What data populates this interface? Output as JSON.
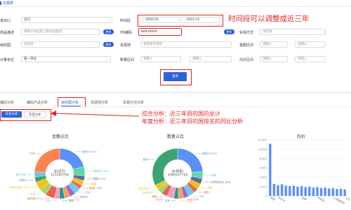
{
  "header": {
    "title": "出报表"
  },
  "form": {
    "export_label": "进出口",
    "export_value": "出口",
    "time_label": "时间段",
    "time_start": "2020-01",
    "time_end": "2022-12",
    "product_desc_label": "商品描述",
    "product_desc_placeholder": "请输入商品或上报商品描述",
    "more_label": "更多",
    "hs_label": "HS编码",
    "hs_value": "84818040",
    "trade_mode_label": "贸易方式",
    "trade_mode_placeholder": "请选择",
    "country_label": "目的国",
    "country_placeholder": "请选择",
    "origin_label": "货源地",
    "origin_placeholder": "请选择货源地",
    "amount_label": "金额区间",
    "amount_placeholder": "请输入",
    "unit_label": "计量单位",
    "unit_value": "第一单位",
    "qty_label": "数量区间",
    "qty_placeholder": "请输入",
    "price_label": "均价区间",
    "price_placeholder": "请输入",
    "query_button": "查询"
  },
  "annotations": {
    "time_note": "时间段可以调整成近三年",
    "analysis_note_1": "综合分析：近三年目的国的总计",
    "analysis_note_2": "年度分析：近三年目的国排名的同比分析"
  },
  "tabs": [
    "编码分析",
    "编码产品分析",
    "目的国分析",
    "货源地分析",
    "贸易方式分析"
  ],
  "subtabs": [
    "综合分析",
    "年度分析"
  ],
  "charts": {
    "amount_title": "金额占比",
    "qty_title": "数量占比",
    "price_title": "均价",
    "amount_center_label": "总(美元)",
    "amount_center_value": "121583708",
    "qty_center_label": "总(数量)",
    "qty_center_value": "3480437784"
  },
  "chart_data": [
    {
      "type": "pie",
      "title": "金额占比",
      "labels": [
        "美国20.54%",
        "墨西哥6.16%",
        "英国3.27%",
        "越南",
        "德国2.58%",
        "印度",
        "新加坡",
        "巴西",
        "泰国",
        "日本",
        "俄罗斯6.27%",
        "土耳其",
        "印度尼西亚5.95%",
        "加拿大",
        "澳大利亚",
        "其他"
      ],
      "values": [
        20.54,
        6.16,
        3.27,
        3.1,
        2.58,
        4.2,
        3.9,
        3.4,
        3.6,
        3.0,
        6.27,
        4.1,
        5.95,
        3.5,
        3.2,
        24.2
      ]
    },
    {
      "type": "pie",
      "title": "数量占比",
      "labels": [
        "美国23.95%",
        "越南",
        "沙特阿拉伯3.84%",
        "英国",
        "德国",
        "印度",
        "巴西",
        "泰国",
        "日本",
        "俄罗斯",
        "韩国",
        "马来西亚",
        "澳大利亚",
        "其他"
      ],
      "values": [
        23.95,
        4.47,
        3.84,
        3.5,
        3.2,
        4.1,
        3.6,
        3.3,
        3.0,
        4.6,
        3.9,
        3.4,
        3.1,
        33.04
      ]
    },
    {
      "type": "bar",
      "title": "均价",
      "categories": [
        "美国",
        "",
        "伊拉克",
        "",
        "",
        "",
        "",
        "",
        "瑞典",
        "",
        "",
        "",
        "阿联酋",
        "",
        "",
        "",
        "土库曼斯坦",
        "",
        "",
        "几内亚共和国"
      ],
      "values": [
        11200,
        2600,
        2300,
        2500,
        2200,
        2100,
        2200,
        2000,
        2100,
        1900,
        2000,
        1800,
        1900,
        1700,
        1800,
        1600,
        1700,
        1500,
        1550,
        1400
      ],
      "ylim": [
        0,
        12000
      ],
      "yticks": [
        "0",
        "2,000",
        "4,000",
        "6,000",
        "8,000",
        "10,000",
        "12,000"
      ]
    }
  ],
  "colors": {
    "primary": "#2d63d8",
    "annotation": "#e02020"
  }
}
